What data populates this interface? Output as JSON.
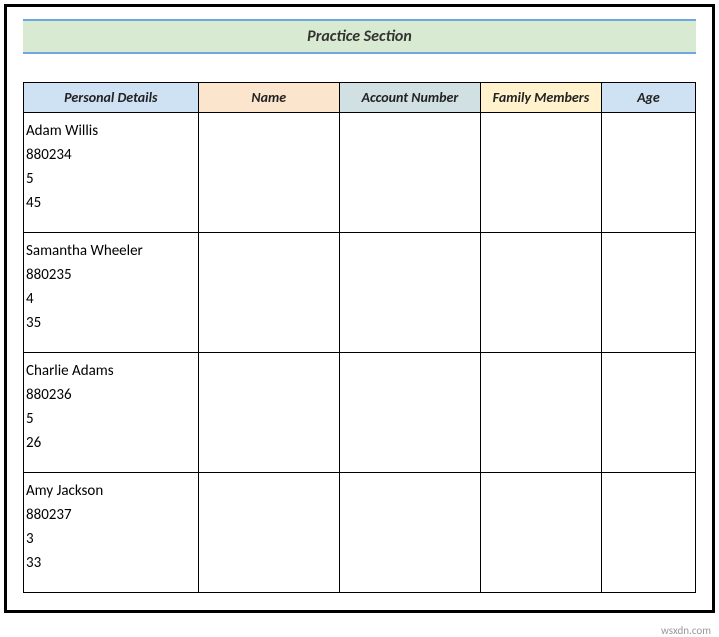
{
  "title": "Practice Section",
  "headers": {
    "personal": "Personal Details",
    "name": "Name",
    "account": "Account Number",
    "family": "Family Members",
    "age": "Age"
  },
  "rows": [
    {
      "personal": {
        "name": "Adam Willis",
        "account": "880234",
        "family": "5",
        "age": "45"
      },
      "name": "",
      "account": "",
      "family": "",
      "age": ""
    },
    {
      "personal": {
        "name": "Samantha Wheeler",
        "account": "880235",
        "family": "4",
        "age": "35"
      },
      "name": "",
      "account": "",
      "family": "",
      "age": ""
    },
    {
      "personal": {
        "name": "Charlie Adams",
        "account": "880236",
        "family": "5",
        "age": "26"
      },
      "name": "",
      "account": "",
      "family": "",
      "age": ""
    },
    {
      "personal": {
        "name": "Amy Jackson",
        "account": "880237",
        "family": "3",
        "age": "33"
      },
      "name": "",
      "account": "",
      "family": "",
      "age": ""
    }
  ],
  "watermark": "wsxdn.com"
}
